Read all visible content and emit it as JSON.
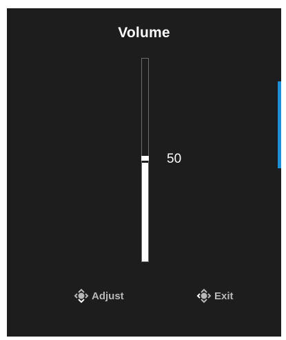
{
  "osd": {
    "title": "Volume",
    "slider": {
      "value": "50",
      "value_fraction": 0.5
    },
    "accent_color": "#1e90d6",
    "background_color": "#1d1d1d"
  },
  "hints": {
    "adjust": {
      "icon": "joystick-up-down-icon",
      "label": "Adjust"
    },
    "exit": {
      "icon": "joystick-left-icon",
      "label": "Exit"
    }
  }
}
